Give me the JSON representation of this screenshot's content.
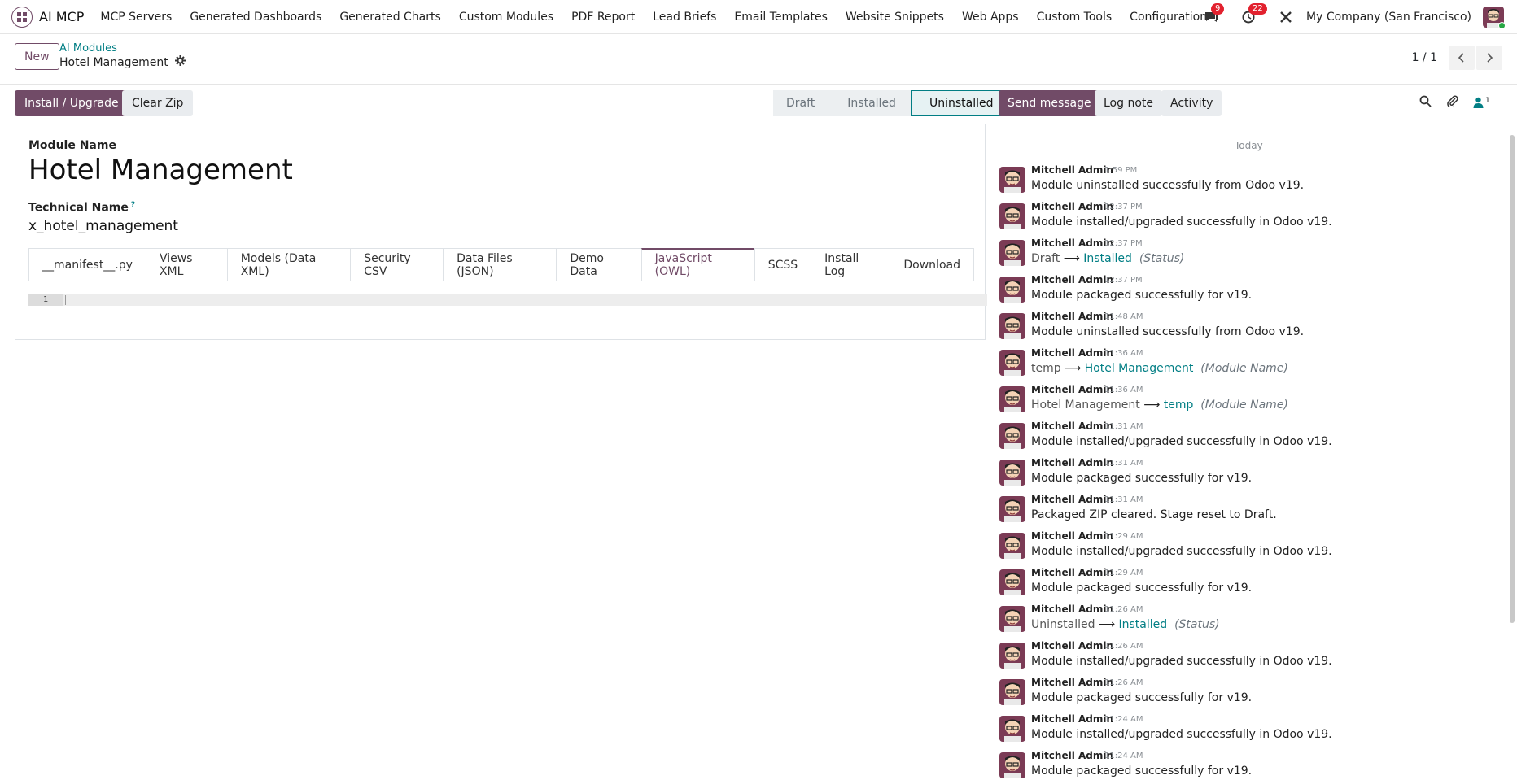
{
  "navbar": {
    "app_name": "AI MCP",
    "menu": [
      "MCP Servers",
      "Generated Dashboards",
      "Generated Charts",
      "Custom Modules",
      "PDF Report",
      "Lead Briefs",
      "Email Templates",
      "Website Snippets",
      "Web Apps",
      "Custom Tools",
      "Configuration"
    ],
    "messages_count": "9",
    "activities_count": "22",
    "company": "My Company (San Francisco)"
  },
  "control": {
    "new_label": "New",
    "breadcrumb_parent": "AI Modules",
    "breadcrumb_current": "Hotel Management",
    "pager": "1 / 1"
  },
  "actions": {
    "install_label": "Install / Upgrade",
    "clear_label": "Clear Zip"
  },
  "status": {
    "stages": [
      "Draft",
      "Installed",
      "Uninstalled"
    ],
    "active": "Uninstalled"
  },
  "form": {
    "module_name_label": "Module Name",
    "module_name": "Hotel Management",
    "technical_name_label": "Technical Name",
    "help_mark": "?",
    "technical_name": "x_hotel_management",
    "tabs": [
      "__manifest__.py",
      "Views XML",
      "Models (Data XML)",
      "Security CSV",
      "Data Files (JSON)",
      "Demo Data",
      "JavaScript (OWL)",
      "SCSS",
      "Install Log",
      "Download"
    ],
    "active_tab": "JavaScript (OWL)",
    "line_number": "1"
  },
  "chatter": {
    "send_label": "Send message",
    "log_label": "Log note",
    "activity_label": "Activity",
    "followers_count": "1",
    "today_label": "Today",
    "messages": [
      {
        "author": "Mitchell Admin",
        "time": "1:59 PM",
        "text": "Module uninstalled successfully from Odoo v19."
      },
      {
        "author": "Mitchell Admin",
        "time": "12:37 PM",
        "text": "Module installed/upgraded successfully in Odoo v19."
      },
      {
        "author": "Mitchell Admin",
        "time": "12:37 PM",
        "tracking": {
          "old": "Draft",
          "new": "Installed",
          "field": "(Status)"
        }
      },
      {
        "author": "Mitchell Admin",
        "time": "12:37 PM",
        "text": "Module packaged successfully for v19."
      },
      {
        "author": "Mitchell Admin",
        "time": "11:48 AM",
        "text": "Module uninstalled successfully from Odoo v19."
      },
      {
        "author": "Mitchell Admin",
        "time": "11:36 AM",
        "tracking": {
          "old": "temp",
          "new": "Hotel Management",
          "field": "(Module Name)"
        }
      },
      {
        "author": "Mitchell Admin",
        "time": "11:36 AM",
        "tracking": {
          "old": "Hotel Management",
          "new": "temp",
          "field": "(Module Name)"
        }
      },
      {
        "author": "Mitchell Admin",
        "time": "11:31 AM",
        "text": "Module installed/upgraded successfully in Odoo v19."
      },
      {
        "author": "Mitchell Admin",
        "time": "11:31 AM",
        "text": "Module packaged successfully for v19."
      },
      {
        "author": "Mitchell Admin",
        "time": "11:31 AM",
        "text": "Packaged ZIP cleared. Stage reset to Draft."
      },
      {
        "author": "Mitchell Admin",
        "time": "11:29 AM",
        "text": "Module installed/upgraded successfully in Odoo v19."
      },
      {
        "author": "Mitchell Admin",
        "time": "11:29 AM",
        "text": "Module packaged successfully for v19."
      },
      {
        "author": "Mitchell Admin",
        "time": "11:26 AM",
        "tracking": {
          "old": "Uninstalled",
          "new": "Installed",
          "field": "(Status)"
        }
      },
      {
        "author": "Mitchell Admin",
        "time": "11:26 AM",
        "text": "Module installed/upgraded successfully in Odoo v19."
      },
      {
        "author": "Mitchell Admin",
        "time": "11:26 AM",
        "text": "Module packaged successfully for v19."
      },
      {
        "author": "Mitchell Admin",
        "time": "11:24 AM",
        "text": "Module installed/upgraded successfully in Odoo v19."
      },
      {
        "author": "Mitchell Admin",
        "time": "11:24 AM",
        "text": "Module packaged successfully for v19."
      }
    ]
  },
  "colors": {
    "brand": "#714B67",
    "accent": "#017e84",
    "badge": "#e2212e"
  }
}
